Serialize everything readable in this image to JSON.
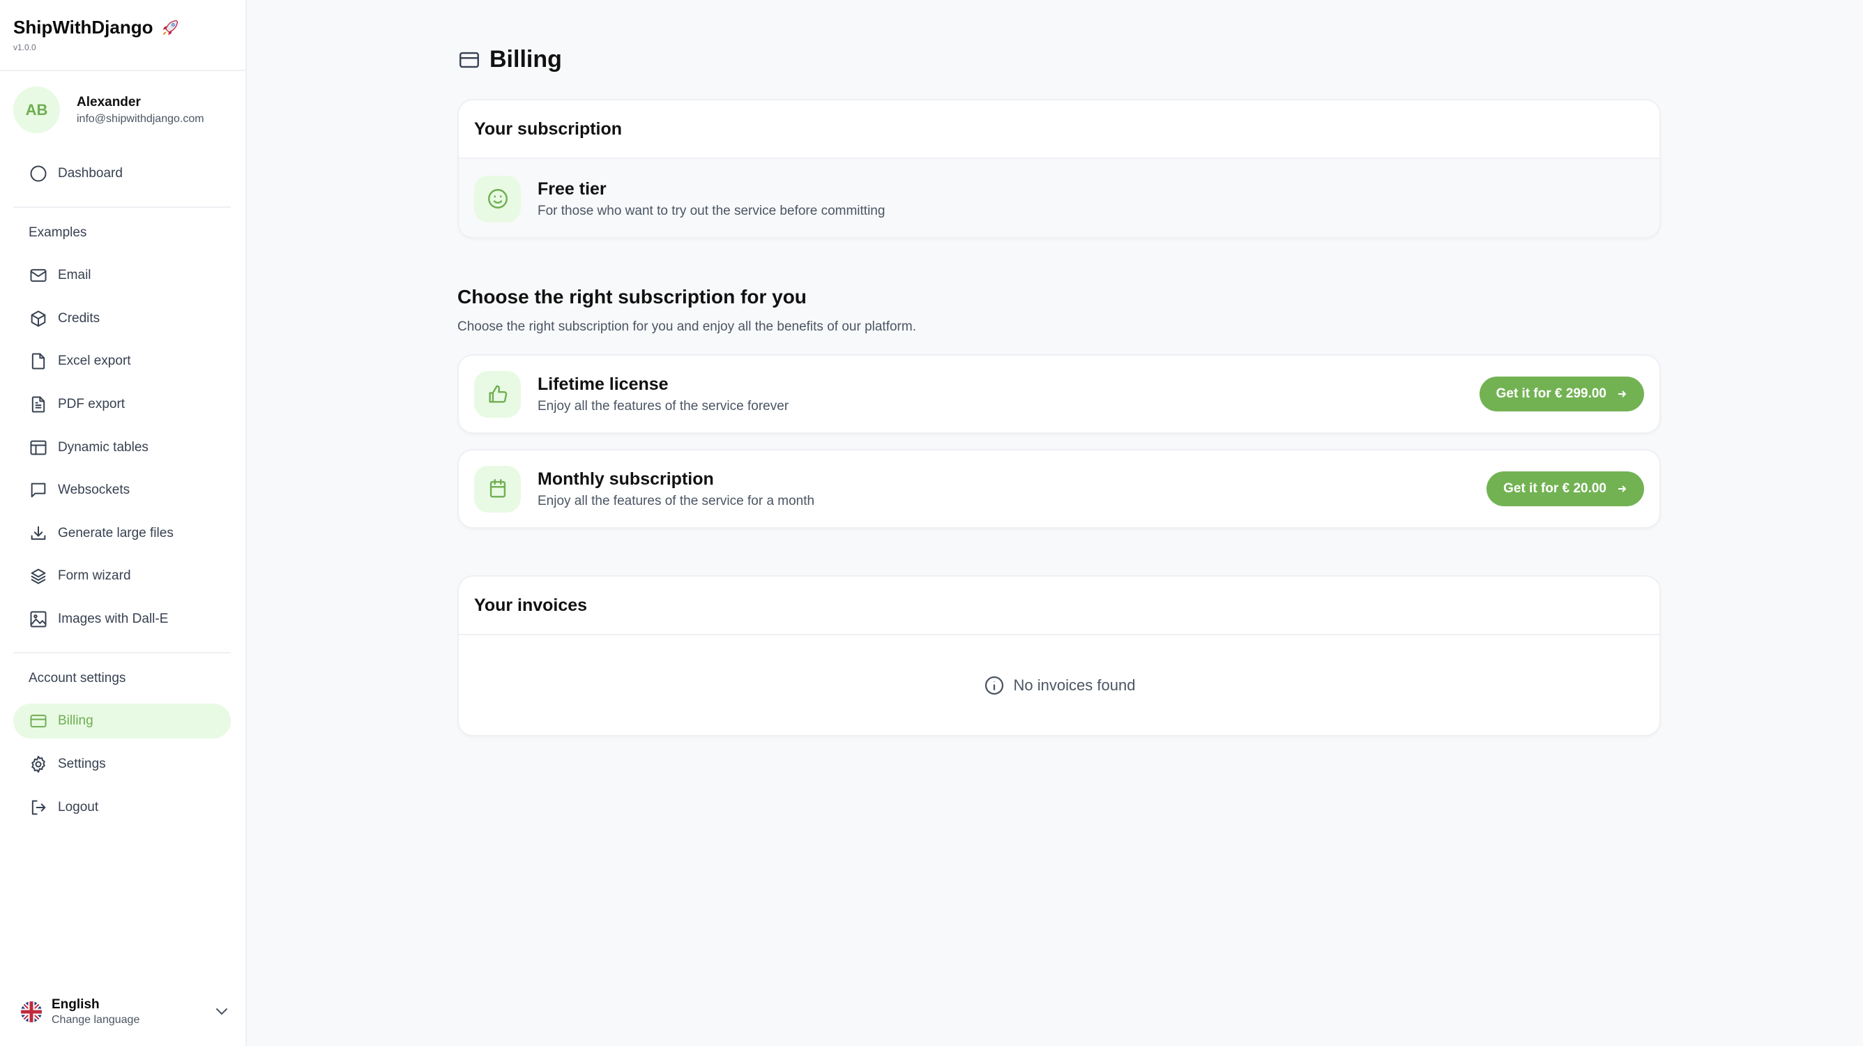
{
  "app": {
    "name": "ShipWithDjango",
    "version": "v1.0.0",
    "logo_icon": "rocket-icon"
  },
  "user": {
    "initials": "AB",
    "name": "Alexander",
    "email": "info@shipwithdjango.com"
  },
  "sidebar": {
    "dashboard": {
      "label": "Dashboard",
      "icon": "circle-icon"
    },
    "examples_label": "Examples",
    "examples": [
      {
        "label": "Email",
        "icon": "mail-icon"
      },
      {
        "label": "Credits",
        "icon": "cube-icon"
      },
      {
        "label": "Excel export",
        "icon": "file-icon"
      },
      {
        "label": "PDF export",
        "icon": "document-text-icon"
      },
      {
        "label": "Dynamic tables",
        "icon": "table-icon"
      },
      {
        "label": "Websockets",
        "icon": "chat-bubble-icon"
      },
      {
        "label": "Generate large files",
        "icon": "download-icon"
      },
      {
        "label": "Form wizard",
        "icon": "layers-icon"
      },
      {
        "label": "Images with Dall-E",
        "icon": "image-icon"
      }
    ],
    "account_label": "Account settings",
    "account": [
      {
        "label": "Billing",
        "icon": "credit-card-icon",
        "active": true
      },
      {
        "label": "Settings",
        "icon": "gear-icon"
      },
      {
        "label": "Logout",
        "icon": "logout-icon"
      }
    ],
    "language": {
      "name": "English",
      "sub": "Change language",
      "flag": "uk-flag-icon"
    }
  },
  "page": {
    "title": "Billing",
    "title_icon": "credit-card-icon",
    "current_subscription": {
      "header": "Your subscription",
      "plan_title": "Free tier",
      "plan_desc": "For those who want to try out the service before committing",
      "icon": "smile-icon"
    },
    "choose": {
      "title": "Choose the right subscription for you",
      "subtitle": "Choose the right subscription for you and enjoy all the benefits of our platform.",
      "plans": [
        {
          "title": "Lifetime license",
          "desc": "Enjoy all the features of the service forever",
          "button": "Get it for € 299.00",
          "icon": "thumbs-up-icon"
        },
        {
          "title": "Monthly subscription",
          "desc": "Enjoy all the features of the service for a month",
          "button": "Get it for € 20.00",
          "icon": "calendar-icon"
        }
      ]
    },
    "invoices": {
      "header": "Your invoices",
      "empty_text": "No invoices found"
    }
  },
  "colors": {
    "accent": "#72b253",
    "accent_light": "#e8fae3",
    "background": "#f8f9fb"
  }
}
